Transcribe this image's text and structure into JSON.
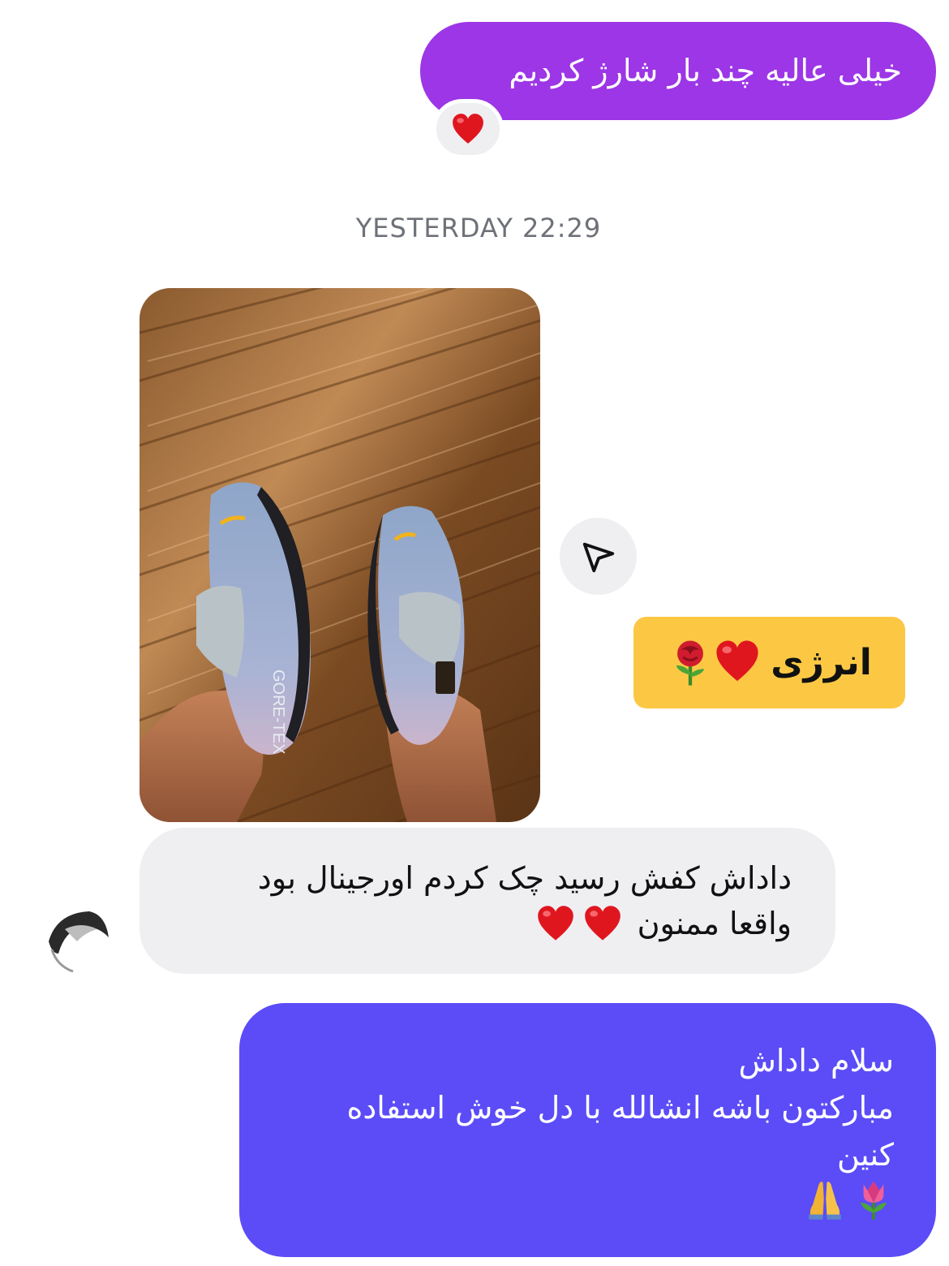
{
  "messages": {
    "outgoing_top": {
      "text": "خیلی عالیه چند بار شارژ کردیم",
      "reaction_icon": "heart-emoji"
    },
    "timestamp": "YESTERDAY 22:29",
    "incoming_photo": {
      "label": "GORE-TEX"
    },
    "incoming_sticker": {
      "text": "انرژی"
    },
    "incoming_text": {
      "line1": "داداش کفش رسید چک کردم اورجینال بود",
      "line2": "واقعا ممنون"
    },
    "outgoing_bottom": {
      "line1": "سلام داداش",
      "line2": "مبارکتون باشه انشالله با دل خوش استفاده",
      "line3": "کنین"
    }
  },
  "colors": {
    "outgoing_top_bg": "#9c36e6",
    "outgoing_bottom_bg": "#5b4cf7",
    "incoming_bg": "#efeff2",
    "sticker_bg": "#fcc844",
    "timestamp": "#6e7178"
  },
  "icons": [
    "heart-emoji",
    "share-send-icon",
    "rose-emoji",
    "tulip-emoji",
    "pray-emoji",
    "avatar"
  ]
}
